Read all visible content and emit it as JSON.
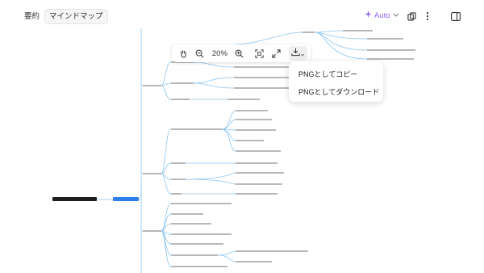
{
  "tabs": [
    {
      "label": "要約"
    },
    {
      "label": "マインドマップ"
    }
  ],
  "header": {
    "auto_label": "Auto",
    "icons": [
      "sparkle-icon",
      "chevron-down-icon",
      "copy-icon",
      "more-vertical-icon",
      "sidebar-toggle-icon"
    ]
  },
  "toolbar": {
    "zoom": "20%",
    "icons": [
      "hand-icon",
      "zoom-out-icon",
      "zoom-in-icon",
      "fit-screen-icon",
      "fullscreen-icon",
      "download-icon"
    ]
  },
  "download_menu": {
    "items": [
      "PNGとしてコピー",
      "PNGとしてダウンロード"
    ]
  },
  "colors": {
    "accent": "#8b5cf6",
    "line": "#8ec5ee",
    "root_node": "#1f1f1f",
    "main_node": "#2f80ed"
  }
}
